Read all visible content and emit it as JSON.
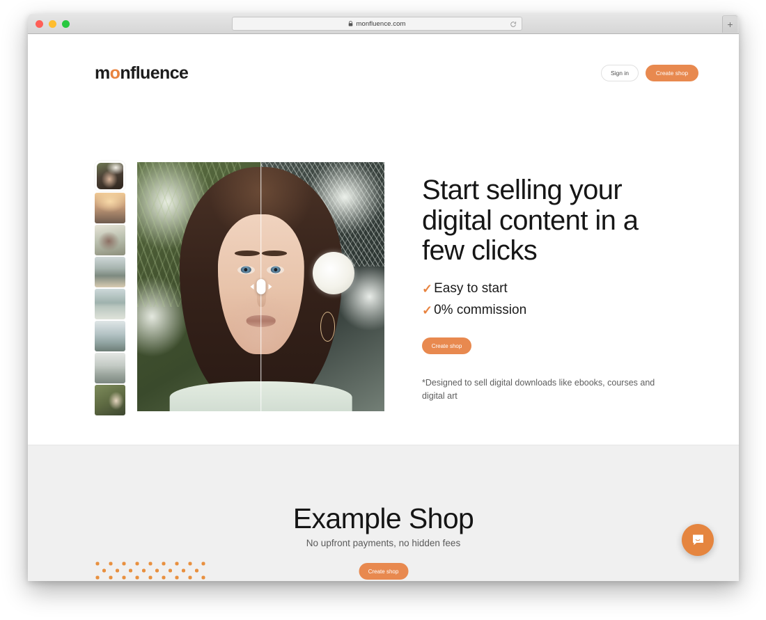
{
  "browser": {
    "url": "monfluence.com",
    "lock_icon": "lock-icon",
    "reload_icon": "reload-icon",
    "newtab_label": "+",
    "traffic_lights": [
      "close",
      "minimize",
      "maximize"
    ]
  },
  "header": {
    "logo_prefix": "m",
    "logo_o": "o",
    "logo_suffix": "nfluence",
    "signin_label": "Sign in",
    "create_shop_label": "Create shop"
  },
  "hero": {
    "title": "Start selling your digital content in a few clicks",
    "benefits": [
      {
        "check": "✓",
        "label": "Easy to start"
      },
      {
        "check": "✓",
        "label": "0% commission"
      }
    ],
    "cta_label": "Create shop",
    "note": "*Designed to sell digital downloads like ebooks, courses and digital art",
    "slider": {
      "handle_icon": "drag-handle-icon",
      "left_arrow": "chevron-left-icon",
      "right_arrow": "chevron-right-icon",
      "position_percent": 50
    },
    "thumbnails": [
      {
        "name": "thumbnail-1",
        "selected": true
      },
      {
        "name": "thumbnail-2",
        "selected": false
      },
      {
        "name": "thumbnail-3",
        "selected": false
      },
      {
        "name": "thumbnail-4",
        "selected": false
      },
      {
        "name": "thumbnail-5",
        "selected": false
      },
      {
        "name": "thumbnail-6",
        "selected": false
      },
      {
        "name": "thumbnail-7",
        "selected": false
      },
      {
        "name": "thumbnail-8",
        "selected": false
      }
    ]
  },
  "shop_section": {
    "title": "Example Shop",
    "subtitle": "No upfront payments, no hidden fees",
    "cta_label": "Create shop"
  },
  "chat": {
    "icon": "chat-bubble-icon"
  },
  "colors": {
    "accent": "#e8894f",
    "accent_dot": "#e8903f",
    "logo_accent": "#e8833f",
    "text": "#161616",
    "muted": "#5d5d5d",
    "section_bg": "#f0f0f0"
  }
}
